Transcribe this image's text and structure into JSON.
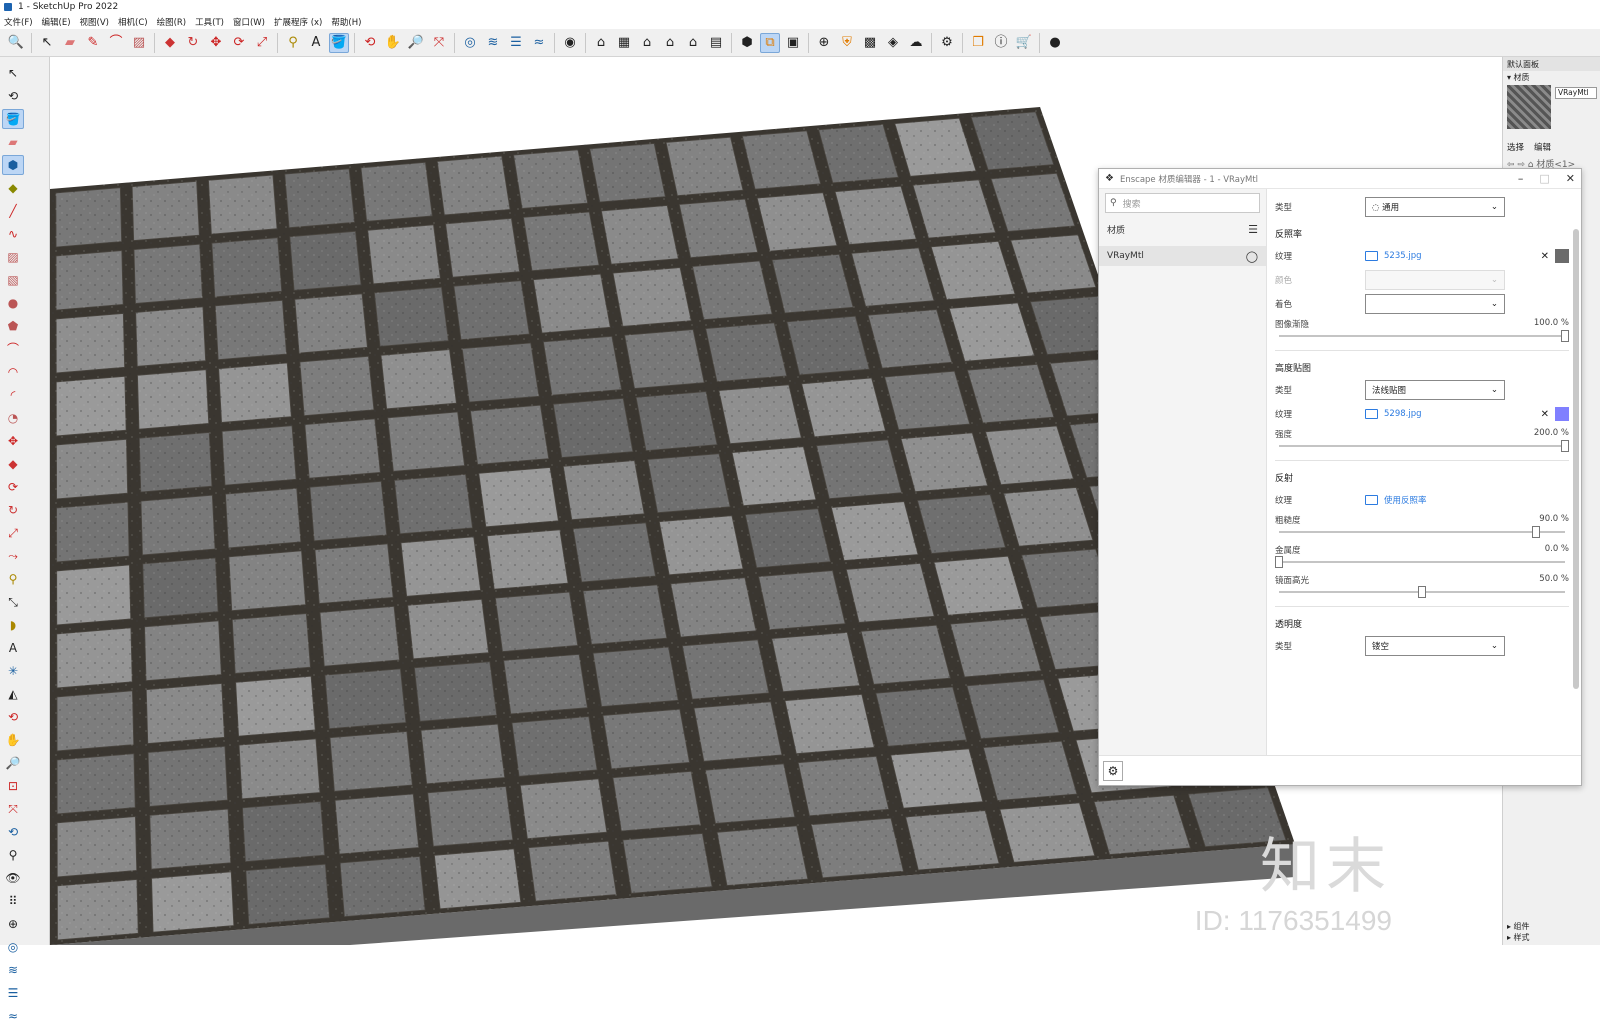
{
  "window": {
    "title": "1 - SketchUp Pro 2022"
  },
  "menu": [
    "文件(F)",
    "编辑(E)",
    "视图(V)",
    "相机(C)",
    "绘图(R)",
    "工具(T)",
    "窗口(W)",
    "扩展程序 (x)",
    "帮助(H)"
  ],
  "toolbar": {
    "icons": [
      "search-icon",
      "select-icon",
      "eraser-icon",
      "pencil-icon",
      "arc-icon",
      "rectangle-icon",
      "pushpull-icon",
      "followme-icon",
      "move-icon",
      "rotate-icon",
      "scale-icon",
      "tape-icon",
      "text-icon",
      "paint-icon",
      "orbit-icon",
      "pan-icon",
      "zoom-icon",
      "zoom-extents-icon",
      "sandbox-icon",
      "layer-icon",
      "house-icon",
      "front-icon",
      "iso-icon",
      "top-icon",
      "right-icon",
      "back-icon",
      "enscape-icon",
      "render-icon",
      "camera-icon",
      "plus-icon",
      "shield-icon",
      "grid-icon",
      "cloud-icon",
      "settings-icon",
      "window-icon",
      "info-icon",
      "cart-icon",
      "user-icon"
    ]
  },
  "right_panel": {
    "title": "默认面板",
    "section": "▾ 材质",
    "material_name": "VRayMtl",
    "tab_select": "选择",
    "tab_edit": "编辑",
    "nav": "⇦ ⇨ ⌂ 材质<1>",
    "bottom_items": [
      "▸ 组件",
      "▸ 样式"
    ]
  },
  "watermark": {
    "logo": "知末",
    "id": "ID: 1176351499"
  },
  "dialog": {
    "title": "Enscape 材质编辑器 - 1 - VRayMtl",
    "search_placeholder": "搜索",
    "materials_label": "材质",
    "material_item": "VRayMtl",
    "type_label": "类型",
    "type_value": "通用",
    "albedo": {
      "title": "反照率",
      "texture_label": "纹理",
      "texture_file": "5235.jpg",
      "color_label": "颜色",
      "tint_label": "着色",
      "fade_label": "图像渐隐",
      "fade_value": "100.0 %",
      "fade_fraction": 1.0,
      "swatch_color": "#6b6b6b"
    },
    "height": {
      "title": "高度贴图",
      "type_label": "类型",
      "type_value": "法线贴图",
      "texture_label": "纹理",
      "texture_file": "5298.jpg",
      "strength_label": "强度",
      "strength_value": "200.0 %",
      "strength_fraction": 1.0,
      "swatch_color": "#8080ff"
    },
    "reflection": {
      "title": "反射",
      "texture_label": "纹理",
      "texture_link": "使用反照率",
      "roughness_label": "粗糙度",
      "roughness_value": "90.0 %",
      "roughness_fraction": 0.9,
      "metallic_label": "金属度",
      "metallic_value": "0.0 %",
      "metallic_fraction": 0.0,
      "specular_label": "镜面高光",
      "specular_value": "50.0 %",
      "specular_fraction": 0.5
    },
    "transparency": {
      "title": "透明度",
      "type_label": "类型",
      "type_value": "镂空"
    }
  }
}
